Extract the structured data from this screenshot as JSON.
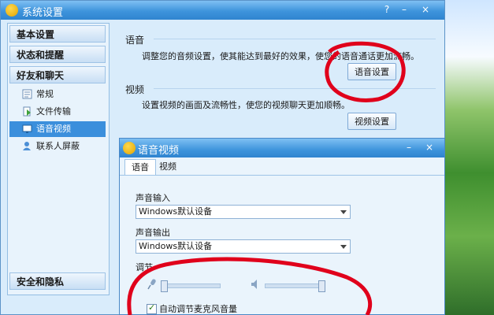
{
  "window": {
    "title": "系统设置",
    "help": "?",
    "minimize": "–",
    "close": "×"
  },
  "sidebar": {
    "categories": [
      "基本设置",
      "状态和提醒",
      "好友和聊天",
      "安全和隐私"
    ],
    "items": [
      {
        "label": "常规",
        "icon": "general-icon"
      },
      {
        "label": "文件传输",
        "icon": "file-transfer-icon"
      },
      {
        "label": "语音视频",
        "icon": "voice-video-icon",
        "selected": true
      },
      {
        "label": "联系人屏蔽",
        "icon": "contact-block-icon"
      }
    ]
  },
  "main": {
    "voice": {
      "label": "语音",
      "desc": "调整您的音频设置，使其能达到最好的效果，使您的语音通话更加流畅。",
      "button": "语音设置"
    },
    "video": {
      "label": "视频",
      "desc": "设置视频的画面及流畅性，使您的视频聊天更加顺畅。",
      "button": "视频设置"
    }
  },
  "dialog": {
    "title": "语音视频",
    "tabs": [
      "语音",
      "视频"
    ],
    "input_label": "声音输入",
    "input_value": "Windows默认设备",
    "output_label": "声音输出",
    "output_value": "Windows默认设备",
    "volume_label": "调节",
    "mic_level": 0.0,
    "speaker_level": 1.0,
    "auto_mic": "自动调节麦克风音量",
    "auto_mic_checked": true
  },
  "colors": {
    "accent": "#3b8fdc",
    "annotation": "#e0001b",
    "titlebar": "#3e94dc"
  }
}
